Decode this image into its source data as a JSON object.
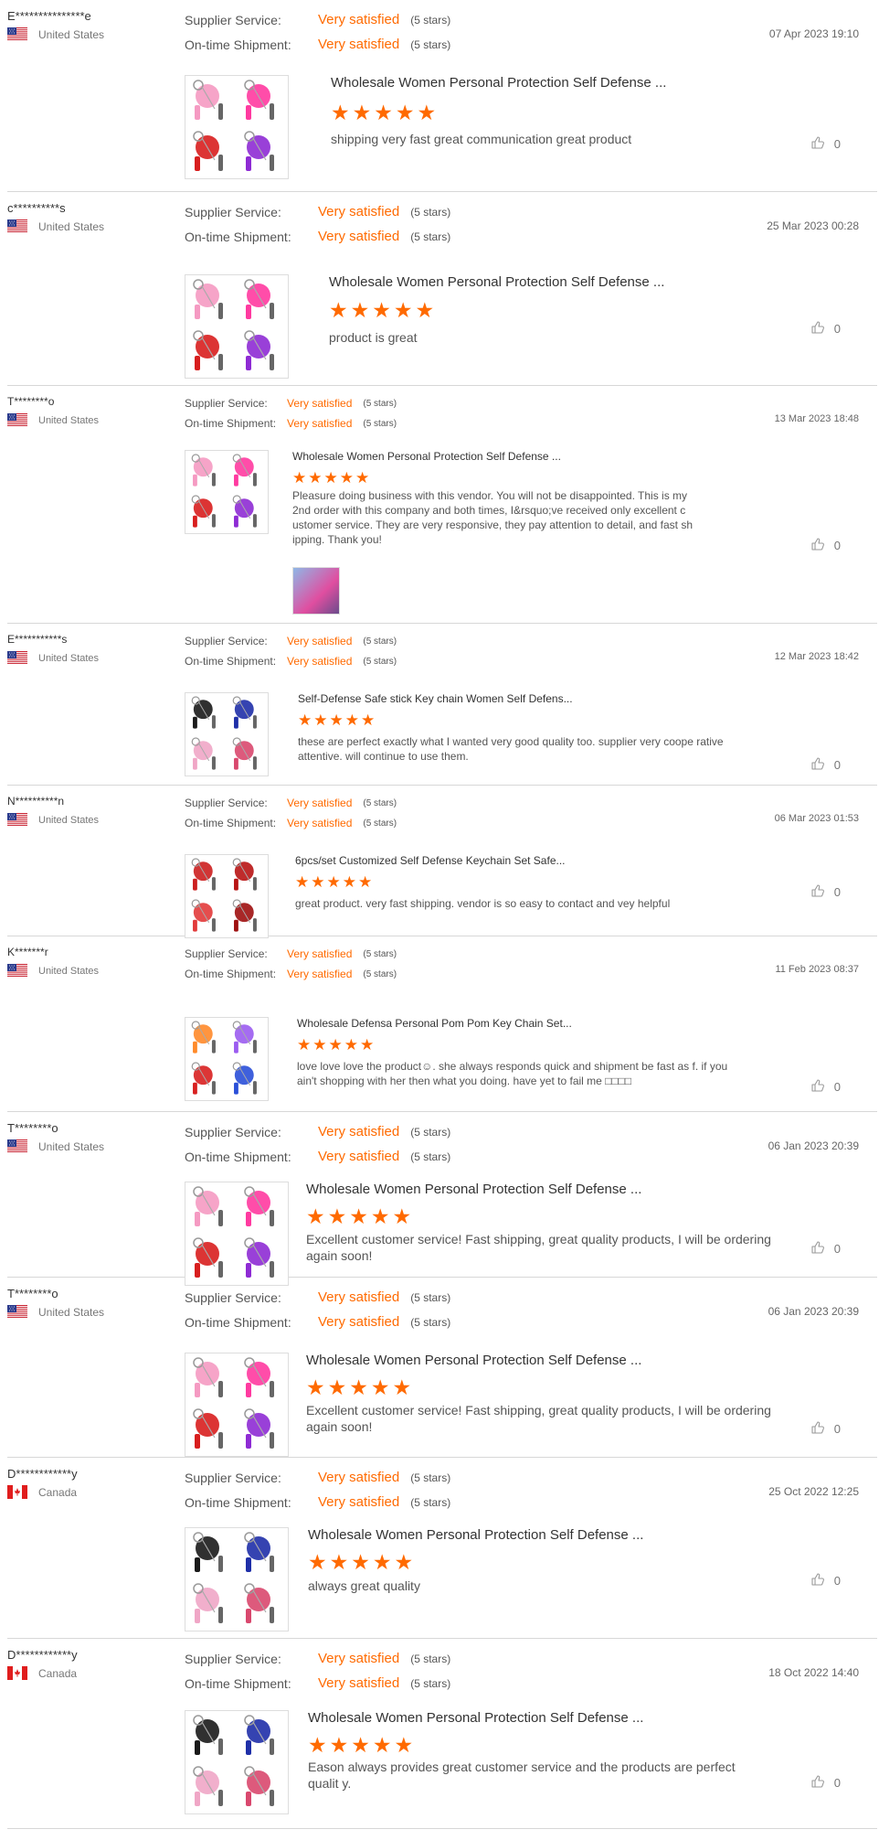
{
  "labels": {
    "supplier_service": "Supplier Service:",
    "on_time_shipment": "On-time Shipment:",
    "very_satisfied": "Very satisfied",
    "five_stars": "(5 stars)"
  },
  "accent_color": "#ff6a00",
  "reviews": [
    {
      "buyer": "E***************e",
      "country": "United States",
      "flag": "us-flag-icon",
      "date": "07 Apr 2023 19:10",
      "product": "Wholesale Women Personal Protection Self Defense ...",
      "rating": 5,
      "text": "shipping very fast great communication great product",
      "likes": "0"
    },
    {
      "buyer": "c**********s",
      "country": "United States",
      "flag": "us-flag-icon",
      "date": "25 Mar 2023 00:28",
      "product": "Wholesale Women Personal Protection Self Defense ...",
      "rating": 5,
      "text": "product is great",
      "likes": "0"
    },
    {
      "buyer": "T********o",
      "country": "United States",
      "flag": "us-flag-icon",
      "date": "13 Mar 2023 18:48",
      "product": "Wholesale Women Personal Protection Self Defense ...",
      "rating": 5,
      "text": "Pleasure doing business with this vendor. You will not be disappointed. This is my 2nd order with this company and both times, I&rsquo;ve received only excellent c ustomer service. They are very responsive, they pay attention to detail, and fast sh ipping. Thank you!",
      "likes": "0"
    },
    {
      "buyer": "E***********s",
      "country": "United States",
      "flag": "us-flag-icon",
      "date": "12 Mar 2023 18:42",
      "product": "Self-Defense Safe stick Key chain Women Self Defens...",
      "rating": 5,
      "text": "these are perfect exactly what I wanted very good quality too. supplier very coope rative attentive. will continue to use them.",
      "likes": "0"
    },
    {
      "buyer": "N**********n",
      "country": "United States",
      "flag": "us-flag-icon",
      "date": "06 Mar 2023 01:53",
      "product": "6pcs/set Customized Self Defense Keychain Set Safe...",
      "rating": 5,
      "text": "great product. very fast shipping. vendor is so easy to contact and vey helpful",
      "likes": "0"
    },
    {
      "buyer": "K*******r",
      "country": "United States",
      "flag": "us-flag-icon",
      "date": "11 Feb 2023 08:37",
      "product": "Wholesale Defensa Personal Pom Pom Key Chain Set...",
      "rating": 5,
      "text": "love love love the product☺. she always responds quick and shipment be fast as f. if you ain't shopping with her then what you doing. have yet to fail me □□□□",
      "likes": "0"
    },
    {
      "buyer": "T********o",
      "country": "United States",
      "flag": "us-flag-icon",
      "date": "06 Jan 2023 20:39",
      "product": "Wholesale Women Personal Protection Self Defense ...",
      "rating": 5,
      "text": "Excellent customer service! Fast shipping, great quality products, I will be ordering again soon!",
      "likes": "0"
    },
    {
      "buyer": "T********o",
      "country": "United States",
      "flag": "us-flag-icon",
      "date": "06 Jan 2023 20:39",
      "product": "Wholesale Women Personal Protection Self Defense ...",
      "rating": 5,
      "text": "Excellent customer service! Fast shipping, great quality products, I will be ordering again soon!",
      "likes": "0"
    },
    {
      "buyer": "D************y",
      "country": "Canada",
      "flag": "canada-flag-icon",
      "date": "25 Oct 2022 12:25",
      "product": "Wholesale Women Personal Protection Self Defense ...",
      "rating": 5,
      "text": "always great quality",
      "likes": "0"
    },
    {
      "buyer": "D************y",
      "country": "Canada",
      "flag": "canada-flag-icon",
      "date": "18 Oct 2022 14:40",
      "product": "Wholesale Women Personal Protection Self Defense ...",
      "rating": 5,
      "text": "Eason always provides great customer service and the products are perfect qualit y.",
      "likes": "0"
    }
  ]
}
